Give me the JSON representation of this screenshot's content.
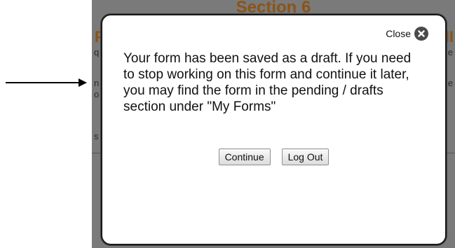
{
  "background": {
    "section_title": "Section 6",
    "left_letter": "F",
    "right_letter": "II",
    "left_fragments": [
      "q",
      "n",
      "o",
      "s"
    ],
    "right_fragments": [
      "e",
      "e"
    ]
  },
  "modal": {
    "close_label": "Close",
    "message": "Your form has been saved as a draft. If you need to stop working on this form and continue it later, you may find the form in the pending / drafts section under \"My Forms\"",
    "continue_label": "Continue",
    "logout_label": "Log Out"
  },
  "icons": {
    "close": "close-icon",
    "arrow": "arrow-right-icon"
  },
  "colors": {
    "backdrop": "#7a7a7a",
    "section_title": "#8a5418",
    "close_icon_bg": "#4a4a4a"
  }
}
